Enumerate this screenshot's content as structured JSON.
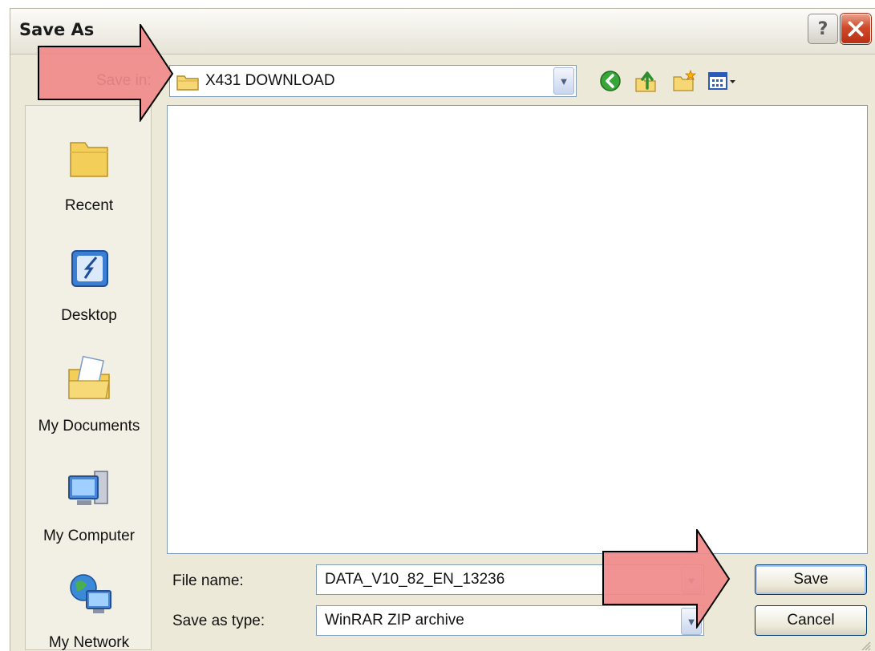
{
  "dialog": {
    "title": "Save As",
    "help_glyph": "?",
    "close_glyph": "✕"
  },
  "toolbar": {
    "save_in_label": "Save in:",
    "save_in_value": "X431 DOWNLOAD",
    "icons": [
      "back-icon",
      "up-one-level-icon",
      "new-folder-icon",
      "views-menu-icon"
    ]
  },
  "places": [
    {
      "label": "Recent",
      "icon": "recent-folder-icon"
    },
    {
      "label": "Desktop",
      "icon": "desktop-icon"
    },
    {
      "label": "My Documents",
      "icon": "my-documents-icon"
    },
    {
      "label": "My Computer",
      "icon": "my-computer-icon"
    },
    {
      "label": "My Network",
      "icon": "my-network-icon"
    }
  ],
  "form": {
    "file_name_label": "File name:",
    "file_name_value": "DATA_V10_82_EN_13236",
    "save_type_label": "Save as type:",
    "save_type_value": "WinRAR ZIP archive"
  },
  "buttons": {
    "save": "Save",
    "cancel": "Cancel"
  },
  "colors": {
    "dialog_bg": "#ece9d8",
    "arrow_fill": "#f08a8a",
    "arrow_border": "#000000",
    "close_red": "#cf4a2a"
  }
}
